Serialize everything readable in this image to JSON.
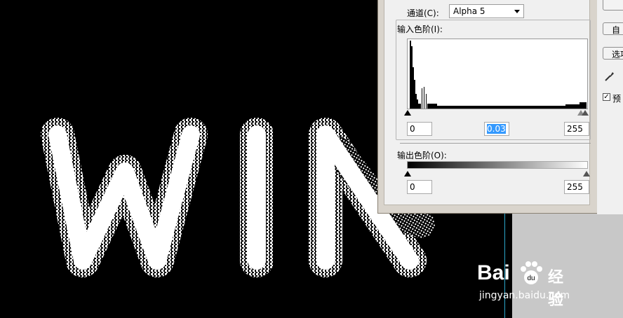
{
  "canvas": {
    "text": "WIN",
    "bg_color": "#000000",
    "right_panel_color": "#c8c8c8",
    "guide_color": "#2aa6c9"
  },
  "dialog": {
    "channel_label": "通道(C):",
    "channel_value": "Alpha 5",
    "input_levels_label": "输入色阶(I):",
    "input_black": "0",
    "input_gamma": "0.03",
    "input_white": "255",
    "output_levels_label": "输出色阶(O):",
    "output_black": "0",
    "output_white": "255",
    "buttons": [
      {
        "label": ""
      },
      {
        "label": "自"
      },
      {
        "label": "选项"
      }
    ],
    "eyedropper_icon": "eyedropper-icon",
    "preview_label": "预",
    "preview_checked": true
  },
  "watermark": {
    "brand_text": "Bai",
    "brand_cn": "经验",
    "url": "jingyan.baidu.com",
    "paw_icon": "paw-icon"
  }
}
